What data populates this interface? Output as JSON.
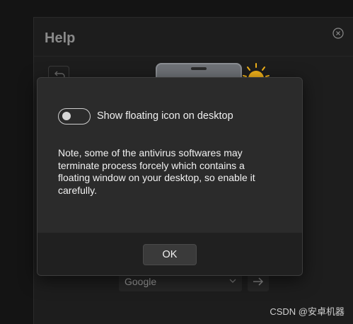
{
  "help_window": {
    "title": "Help",
    "search_engine_select": {
      "value": "Google"
    }
  },
  "dialog": {
    "toggle": {
      "label": "Show floating icon on desktop",
      "checked": false
    },
    "note": "Note, some of the antivirus softwares may terminate process forcely which contains a floating window on your desktop, so enable it carefully.",
    "ok_label": "OK"
  },
  "watermark": "CSDN @安卓机器",
  "colors": {
    "background": "#141414",
    "dialog": "#2b2b2b",
    "footer": "#202020",
    "sun": "#f0b11a"
  },
  "icons": [
    "close-icon",
    "back-icon",
    "device-illustration",
    "sun-icon",
    "chevron-down-icon",
    "arrow-right-icon"
  ]
}
